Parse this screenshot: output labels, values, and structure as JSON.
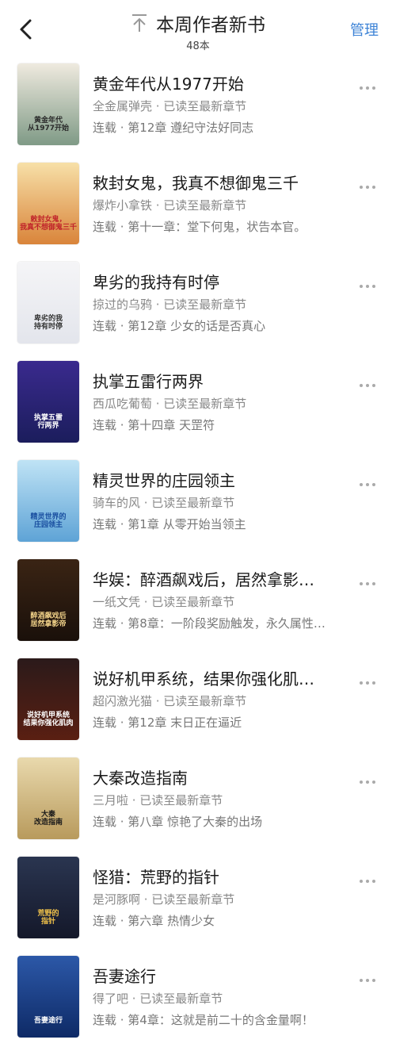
{
  "header": {
    "title": "本周作者新书",
    "count": "48本",
    "manage_label": "管理"
  },
  "books": [
    {
      "title": "黄金年代从1977开始",
      "meta": "全金属弹壳 · 已读至最新章节",
      "chapter": "连载 · 第12章 遵纪守法好同志",
      "cover_text": "黄金年代\n从1977开始",
      "cover_colors": [
        "#efeadf",
        "#7f9a86"
      ],
      "text_color": "#2a2a2a"
    },
    {
      "title": "敕封女鬼，我真不想御鬼三千",
      "meta": "爆炸小拿铁 · 已读至最新章节",
      "chapter": "连载 · 第十一章：堂下何鬼，状告本官。",
      "cover_text": "敕封女鬼，\n我真不想御鬼三千",
      "cover_colors": [
        "#f7e0a8",
        "#d9843a"
      ],
      "text_color": "#c0232a"
    },
    {
      "title": "卑劣的我持有时停",
      "meta": "掠过的乌鸦 · 已读至最新章节",
      "chapter": "连载 · 第12章 少女的话是否真心",
      "cover_text": "卑劣的我\n持有时停",
      "cover_colors": [
        "#f5f5f7",
        "#e3e5ec"
      ],
      "text_color": "#333333"
    },
    {
      "title": "执掌五雷行两界",
      "meta": "西瓜吃葡萄 · 已读至最新章节",
      "chapter": "连载 · 第十四章 天罡符",
      "cover_text": "执掌五雷\n行两界",
      "cover_colors": [
        "#3a2a8e",
        "#1b1d5c"
      ],
      "text_color": "#ffffff"
    },
    {
      "title": "精灵世界的庄园领主",
      "meta": "骑车的风 · 已读至最新章节",
      "chapter": "连载 · 第1章 从零开始当领主",
      "cover_text": "精灵世界的\n庄园领主",
      "cover_colors": [
        "#bfe3f5",
        "#5ea3d6"
      ],
      "text_color": "#1a4fa0"
    },
    {
      "title": "华娱：醉酒飙戏后，居然拿影…",
      "meta": "一纸文凭 · 已读至最新章节",
      "chapter": "连载 · 第8章：一阶段奖励触发，永久属性…",
      "cover_text": "醉酒飙戏后\n居然拿影帝",
      "cover_colors": [
        "#3a2414",
        "#1a100a"
      ],
      "text_color": "#f3d38a"
    },
    {
      "title": "说好机甲系统，结果你强化肌…",
      "meta": "超闪激光猫 · 已读至最新章节",
      "chapter": "连载 · 第12章 末日正在逼近",
      "cover_text": "说好机甲系统\n结果你强化肌肉",
      "cover_colors": [
        "#2b1a1a",
        "#5a1f12"
      ],
      "text_color": "#ffffff"
    },
    {
      "title": "大秦改造指南",
      "meta": "三月啦 · 已读至最新章节",
      "chapter": "连载 · 第八章 惊艳了大秦的出场",
      "cover_text": "大秦\n改造指南",
      "cover_colors": [
        "#e9d9ad",
        "#b89a5c"
      ],
      "text_color": "#1a1a1a"
    },
    {
      "title": "怪猎：荒野的指针",
      "meta": "是河豚啊 · 已读至最新章节",
      "chapter": "连载 · 第六章 热情少女",
      "cover_text": "荒野的\n指针",
      "cover_colors": [
        "#2a3550",
        "#14182a"
      ],
      "text_color": "#f2c34a"
    },
    {
      "title": "吾妻途行",
      "meta": "得了吧 · 已读至最新章节",
      "chapter": "连载 · 第4章：这就是前二十的含金量啊！",
      "cover_text": "吾妻途行",
      "cover_colors": [
        "#2c58a8",
        "#0e2a66"
      ],
      "text_color": "#ffffff"
    }
  ]
}
